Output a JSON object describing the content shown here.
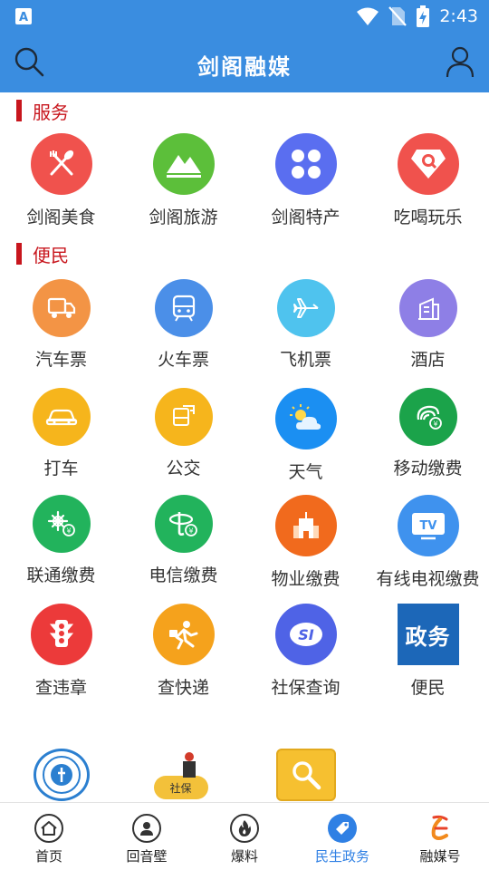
{
  "status_bar": {
    "time": "2:43",
    "app_badge_icon": "app-store-icon"
  },
  "header": {
    "title": "剑阁融媒",
    "search_icon": "search-icon",
    "user_icon": "user-icon"
  },
  "sections": {
    "service": {
      "title": "服务"
    },
    "convenience": {
      "title": "便民"
    }
  },
  "service_items": [
    {
      "label": "剑阁美食",
      "icon": "food-icon",
      "color": "#f0524d"
    },
    {
      "label": "剑阁旅游",
      "icon": "mountain-icon",
      "color": "#5cbf3a"
    },
    {
      "label": "剑阁特产",
      "icon": "grid-dots-icon",
      "color": "#5a6ef0"
    },
    {
      "label": "吃喝玩乐",
      "icon": "diamond-search-icon",
      "color": "#f0524d"
    }
  ],
  "convenience_items": [
    {
      "label": "汽车票",
      "icon": "truck-icon",
      "color": "#f39445"
    },
    {
      "label": "火车票",
      "icon": "train-icon",
      "color": "#4b8fe8"
    },
    {
      "label": "飞机票",
      "icon": "airplane-icon",
      "color": "#4fc3ee"
    },
    {
      "label": "酒店",
      "icon": "building-icon",
      "color": "#8e7fe6"
    },
    {
      "label": "打车",
      "icon": "car-icon",
      "color": "#f6b51c"
    },
    {
      "label": "公交",
      "icon": "bus-icon",
      "color": "#f6b51c"
    },
    {
      "label": "天气",
      "icon": "weather-icon",
      "color": "#1b8ff2"
    },
    {
      "label": "移动缴费",
      "icon": "china-mobile-icon",
      "color": "#1ba34a"
    },
    {
      "label": "联通缴费",
      "icon": "china-unicom-icon",
      "color": "#22b35c"
    },
    {
      "label": "电信缴费",
      "icon": "china-telecom-icon",
      "color": "#22b35c"
    },
    {
      "label": "物业缴费",
      "icon": "property-icon",
      "color": "#f16a1d"
    },
    {
      "label": "有线电视缴费",
      "icon": "tv-icon",
      "color": "#3f92ee"
    },
    {
      "label": "查违章",
      "icon": "traffic-light-icon",
      "color": "#ec3a3a"
    },
    {
      "label": "查快递",
      "icon": "courier-icon",
      "color": "#f5a21c"
    },
    {
      "label": "社保查询",
      "icon": "social-security-icon",
      "color": "#4f63e6"
    },
    {
      "label": "便民",
      "icon": "government-affairs-icon",
      "color": "#1c67b8",
      "icon_text": "政务"
    }
  ],
  "extra_items": [
    {
      "icon": "school-emblem-icon"
    },
    {
      "icon": "social-insurance-icon",
      "icon_text": "社保"
    },
    {
      "icon": "yellow-search-icon"
    }
  ],
  "tab_bar": [
    {
      "label": "首页",
      "icon": "home-icon",
      "active": false
    },
    {
      "label": "回音壁",
      "icon": "person-icon",
      "active": false
    },
    {
      "label": "爆料",
      "icon": "fire-icon",
      "active": false
    },
    {
      "label": "民生政务",
      "icon": "tag-icon",
      "active": true
    },
    {
      "label": "融媒号",
      "icon": "media-logo-icon",
      "active": false
    }
  ]
}
